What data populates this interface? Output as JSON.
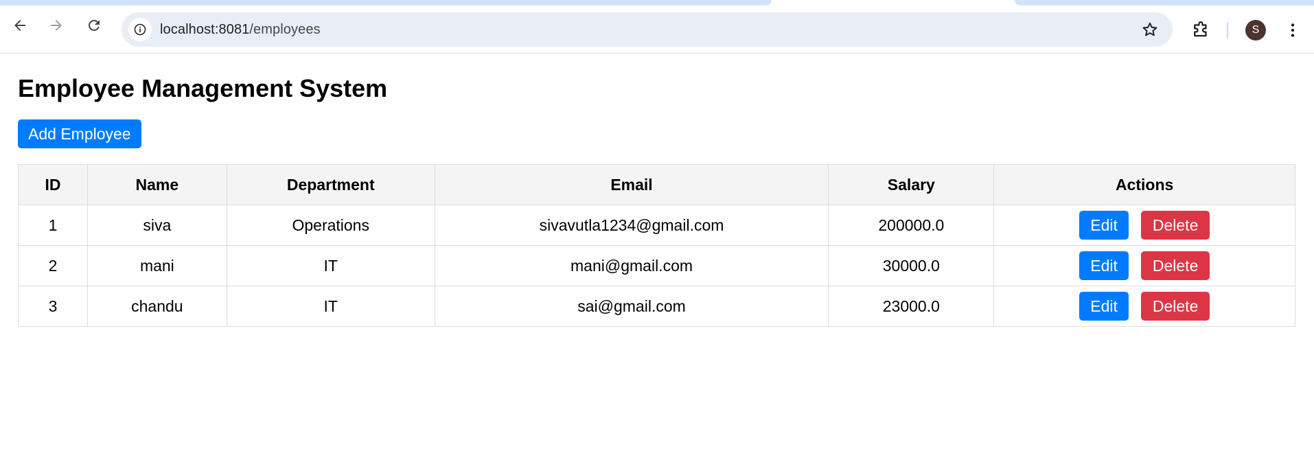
{
  "browser": {
    "url_host": "localhost:8081",
    "url_path": "/employees",
    "avatar_letter": "S",
    "icons": {
      "back": "arrow-left-icon",
      "forward": "arrow-right-icon",
      "reload": "reload-icon",
      "site_info": "info-icon",
      "bookmark": "star-icon",
      "extensions": "puzzle-icon",
      "menu": "kebab-menu-icon"
    }
  },
  "page": {
    "title": "Employee Management System",
    "add_button_label": "Add Employee"
  },
  "table": {
    "headers": [
      "ID",
      "Name",
      "Department",
      "Email",
      "Salary",
      "Actions"
    ],
    "rows": [
      {
        "id": "1",
        "name": "siva",
        "department": "Operations",
        "email": "sivavutla1234@gmail.com",
        "salary": "200000.0"
      },
      {
        "id": "2",
        "name": "mani",
        "department": "IT",
        "email": "mani@gmail.com",
        "salary": "30000.0"
      },
      {
        "id": "3",
        "name": "chandu",
        "department": "IT",
        "email": "sai@gmail.com",
        "salary": "23000.0"
      }
    ],
    "edit_label": "Edit",
    "delete_label": "Delete"
  },
  "colors": {
    "primary": "#007bff",
    "danger": "#dc3545",
    "header_bg": "#f4f4f4",
    "border": "#dddddd",
    "omnibox_bg": "#e9eef6"
  }
}
